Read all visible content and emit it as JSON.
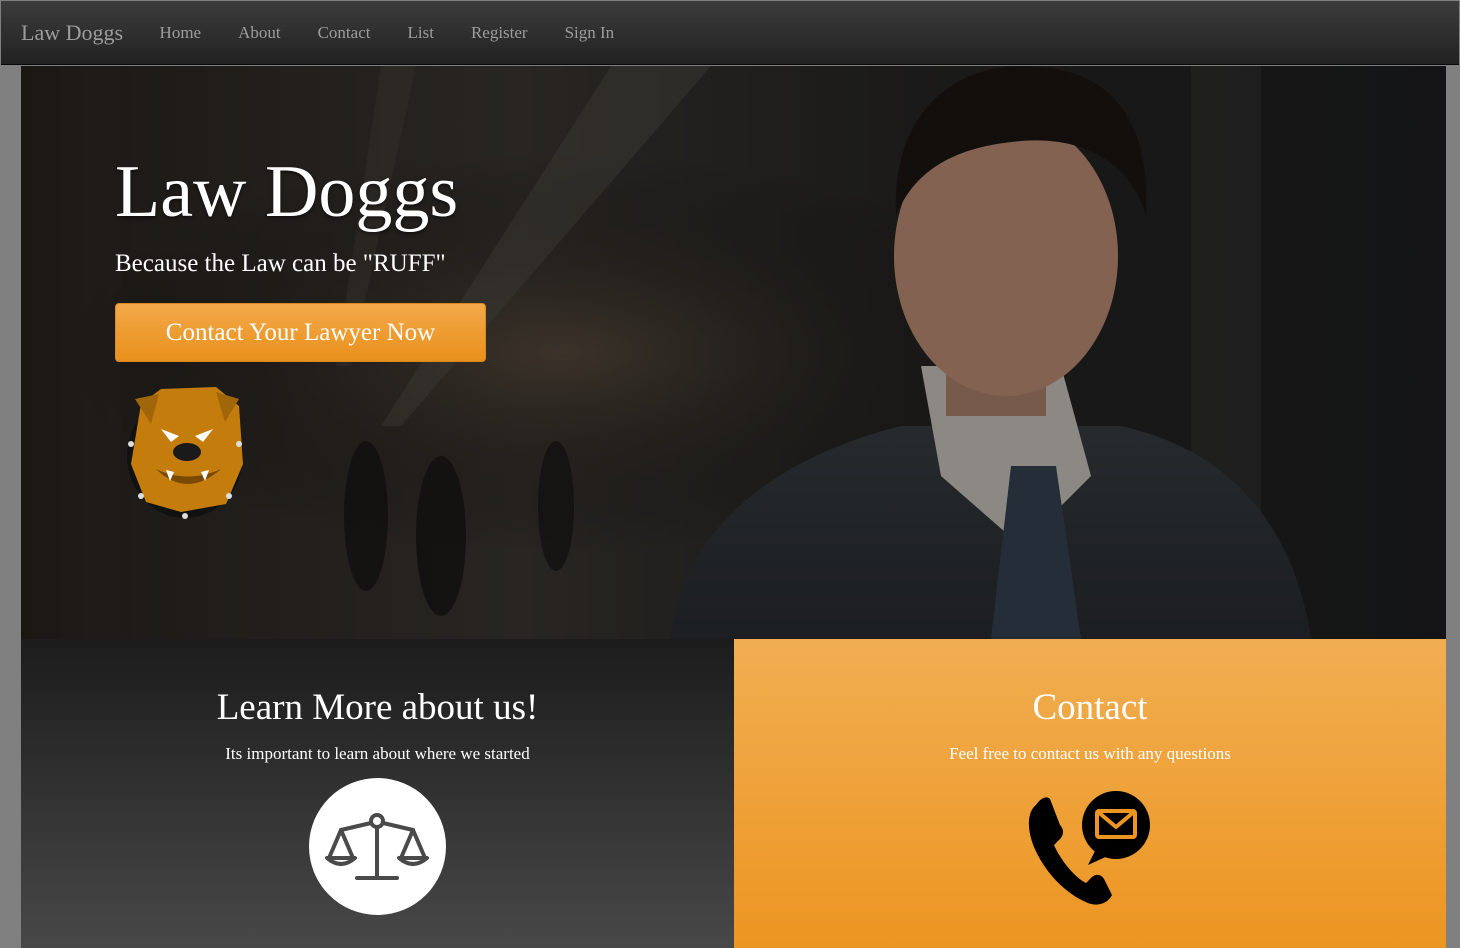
{
  "navbar": {
    "brand": "Law Doggs",
    "links": [
      "Home",
      "About",
      "Contact",
      "List",
      "Register",
      "Sign In"
    ]
  },
  "hero": {
    "title": "Law Doggs",
    "subtitle": "Because the Law can be \"RUFF\"",
    "cta_label": "Contact Your Lawyer Now",
    "logo_icon": "bulldog-logo",
    "background": "office-hallway-businessman-photo"
  },
  "panels": {
    "about": {
      "title": "Learn More about us!",
      "text": "Its important to learn about where we started",
      "icon": "scales-of-justice-icon"
    },
    "contact": {
      "title": "Contact",
      "text": "Feel free to contact us with any questions",
      "icon": "phone-and-mail-icon"
    }
  },
  "colors": {
    "accent": "#ec9521",
    "navbar": "#222222",
    "nav_text": "#9d9d9d",
    "dark_panel": "#2e2e2e"
  }
}
